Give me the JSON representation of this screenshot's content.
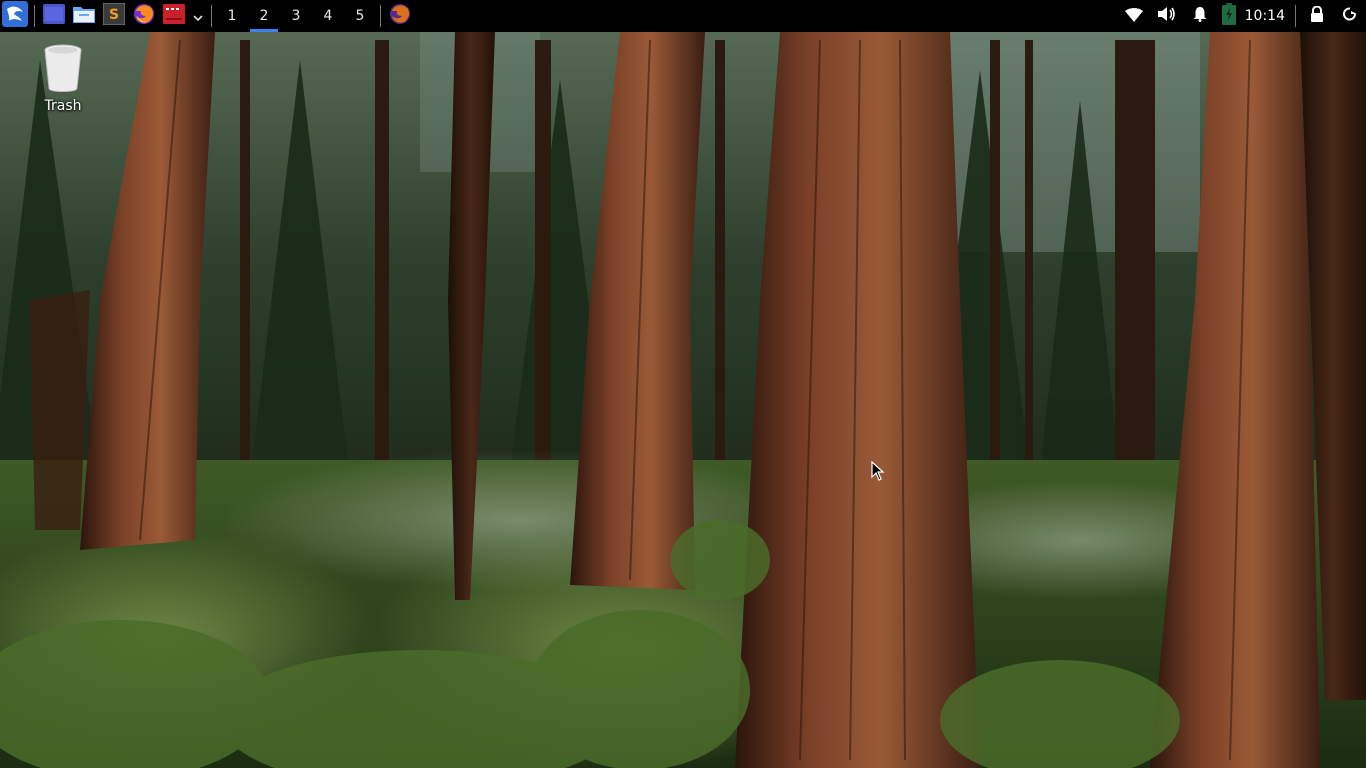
{
  "panel": {
    "launchers": [
      {
        "name": "kali-menu-icon"
      },
      {
        "name": "terminal-icon"
      },
      {
        "name": "file-manager-icon"
      },
      {
        "name": "sublime-text-icon"
      },
      {
        "name": "firefox-icon"
      },
      {
        "name": "red-app-icon"
      }
    ],
    "workspaces": [
      "1",
      "2",
      "3",
      "4",
      "5"
    ],
    "active_workspace": "2",
    "tray": {
      "clock": "10:14"
    }
  },
  "desktop": {
    "icons": [
      {
        "label": "Trash",
        "icon": "trash-icon"
      }
    ]
  },
  "colors": {
    "panel_bg": "#000000",
    "active_workspace_indicator": "#3b82f6",
    "desktop_text": "#ffffff"
  }
}
